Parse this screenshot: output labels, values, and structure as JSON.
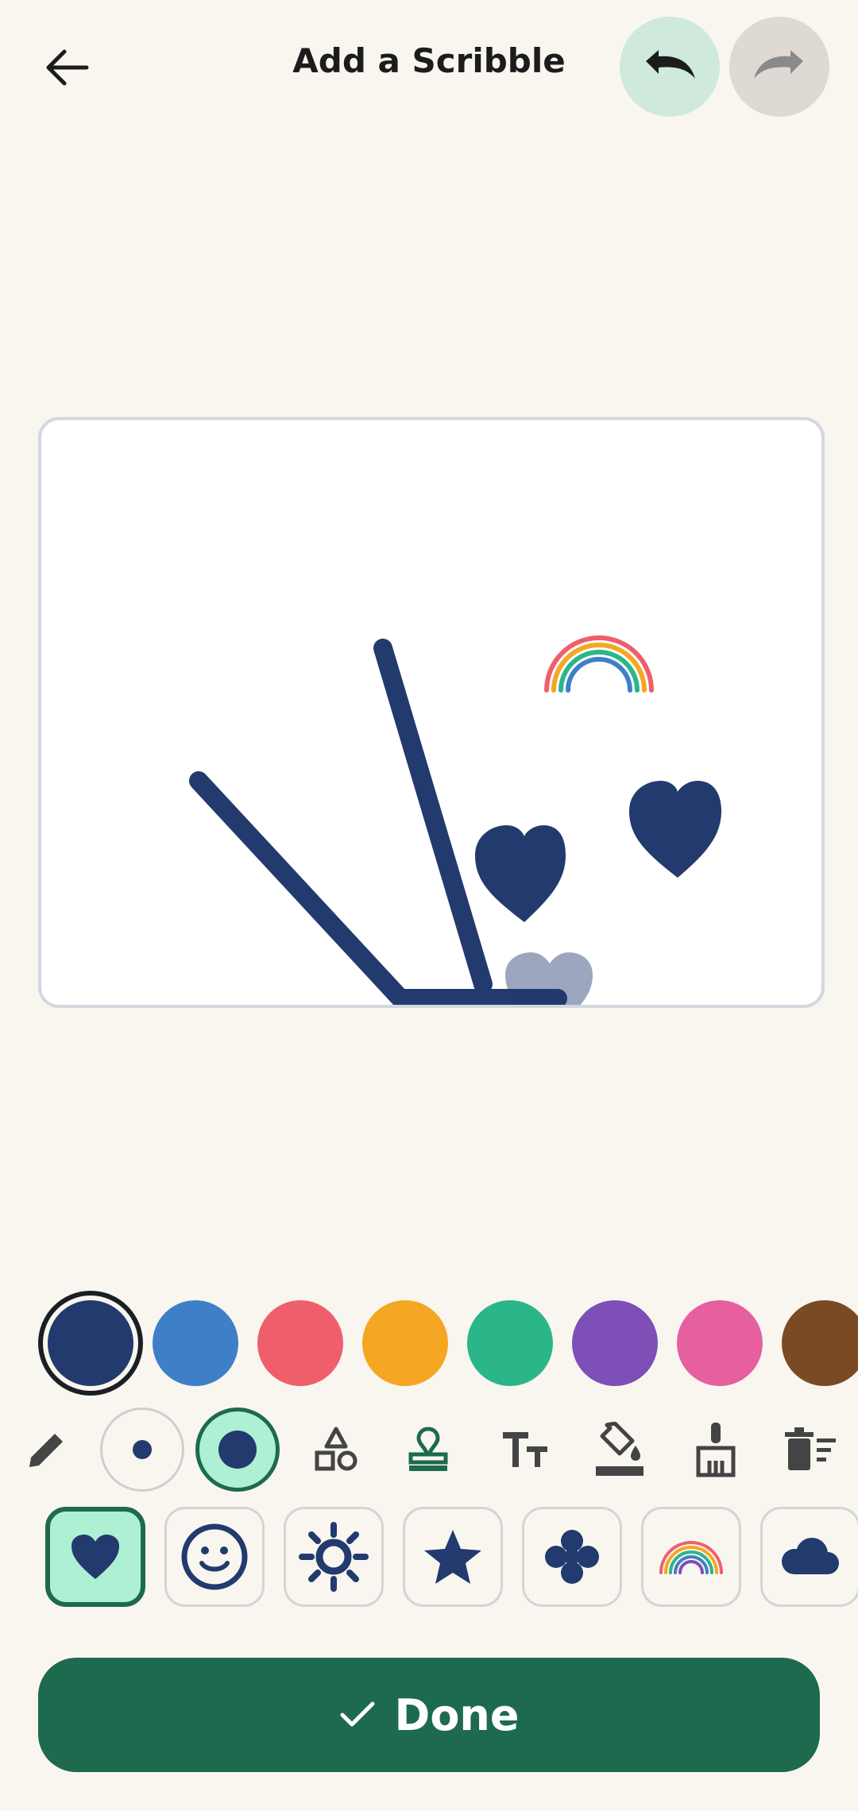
{
  "header": {
    "title": "Add a Scribble"
  },
  "colors": {
    "swatches": [
      "#233a6e",
      "#3e7fc8",
      "#ef5f6b",
      "#f5a623",
      "#2bb68a",
      "#7e4fb6",
      "#e65f9e",
      "#7a4b22"
    ],
    "selected": "#233a6e",
    "accent_green": "#1e6a4f",
    "mint": "#aef0d3"
  },
  "tools": [
    "pencil-icon",
    "small-brush",
    "large-brush",
    "shapes-icon",
    "stamp-icon",
    "text-size-icon",
    "fill-bucket-icon",
    "broom-icon",
    "clear-all-icon"
  ],
  "stamps": [
    "heart",
    "smiley",
    "sun",
    "star",
    "flower",
    "rainbow",
    "cloud"
  ],
  "done": {
    "label": "Done"
  }
}
